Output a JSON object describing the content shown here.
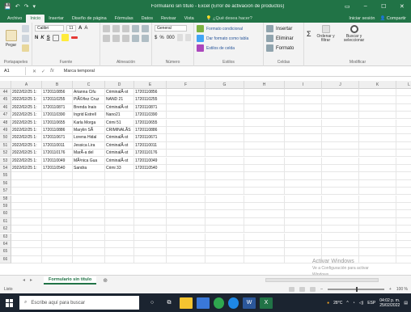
{
  "window": {
    "title": "Formulario sin título - Excel (Error de activación de productos)",
    "controls": {
      "ribbon_options": "▭",
      "minimize": "–",
      "maximize": "☐",
      "close": "✕"
    },
    "quick_access": [
      "💾",
      "↶",
      "↷",
      "▾"
    ]
  },
  "tabs": {
    "items": [
      "Archivo",
      "Inicio",
      "Insertar",
      "Diseño de página",
      "Fórmulas",
      "Datos",
      "Revisar",
      "Vista"
    ],
    "active_index": 1,
    "search": "¿Qué desea hacer?",
    "signin": "Iniciar sesión",
    "share": "Compartir"
  },
  "ribbon": {
    "clipboard": {
      "paste": "Pegar",
      "label": "Portapapeles"
    },
    "font": {
      "name": "Calibri",
      "size": "11",
      "label": "Fuente",
      "bold": "N",
      "italic": "K",
      "underline": "S",
      "grow": "A",
      "shrink": "A"
    },
    "alignment": {
      "label": "Alineación"
    },
    "number": {
      "format": "General",
      "label": "Número",
      "currency": "$",
      "percent": "%",
      "thousands": "000"
    },
    "styles": {
      "conditional": "Formato condicional",
      "as_table": "Dar formato como tabla",
      "cell_styles": "Estilos de celda",
      "label": "Estilos"
    },
    "cells": {
      "insert": "Insertar",
      "delete": "Eliminar",
      "format": "Formato",
      "label": "Celdas"
    },
    "editing": {
      "sort": "Ordenar y filtrar",
      "find": "Buscar y seleccionar",
      "label": "Modificar"
    }
  },
  "formula_bar": {
    "name_box": "A1",
    "fx": "fx",
    "cancel": "✕",
    "enter": "✓",
    "content": "Marca temporal"
  },
  "columns": [
    "A",
    "B",
    "C",
    "D",
    "E",
    "F",
    "G",
    "H",
    "I",
    "J",
    "K",
    "L"
  ],
  "rows": [
    {
      "n": "44",
      "a": "2022/02/25 1:",
      "b": "1720110856",
      "c": "Arianna Cifu",
      "d": "CriminalÃ-st",
      "e": "1720110856"
    },
    {
      "n": "45",
      "a": "2022/02/25 1:",
      "b": "1720110255",
      "c": "PiÃ©ñez Cruz",
      "d": "NAND 21",
      "e": "1720110255"
    },
    {
      "n": "46",
      "a": "2022/02/25 1:",
      "b": "1720110871",
      "c": "Brenda Inais",
      "d": "CriminalÃ-st",
      "e": "1720110871"
    },
    {
      "n": "47",
      "a": "2022/02/25 1:",
      "b": "1720110390",
      "c": "Ingrid Estrell",
      "d": "Nano21",
      "e": "1720110390"
    },
    {
      "n": "48",
      "a": "2022/02/25 1:",
      "b": "1720110655",
      "c": "Karla Morga",
      "d": "Crimi 51",
      "e": "1720110655"
    },
    {
      "n": "49",
      "a": "2022/02/25 1:",
      "b": "1720110886",
      "c": "Marylin SÃ",
      "d": "CRIMINALÃS",
      "e": "1720110886"
    },
    {
      "n": "50",
      "a": "2022/02/25 1:",
      "b": "1720110671",
      "c": "Lorena Hidal",
      "d": "CriminalÃ-st",
      "e": "1720110671"
    },
    {
      "n": "51",
      "a": "2022/02/25 1:",
      "b": "1720110011",
      "c": "Jessica Lira",
      "d": "CriminalÃ-st",
      "e": "1720110011"
    },
    {
      "n": "52",
      "a": "2022/02/25 1:",
      "b": "1720110176",
      "c": "MarÃ-a del",
      "d": "CriminalÃ-st",
      "e": "1720110176"
    },
    {
      "n": "53",
      "a": "2022/02/25 1:",
      "b": "1720110049",
      "c": "MÃ³nica Gua",
      "d": "CriminalÃ-st",
      "e": "1720110049"
    },
    {
      "n": "54",
      "a": "2022/02/25 1:",
      "b": "1720110540",
      "c": "Sandra",
      "d": "Crimi 33",
      "e": "1720110540"
    },
    {
      "n": "55"
    },
    {
      "n": "56"
    },
    {
      "n": "57"
    },
    {
      "n": "58"
    },
    {
      "n": "59"
    },
    {
      "n": "60"
    },
    {
      "n": "61"
    },
    {
      "n": "62"
    },
    {
      "n": "63"
    },
    {
      "n": "64"
    },
    {
      "n": "65"
    },
    {
      "n": "66"
    }
  ],
  "watermark": {
    "line1": "Activar Windows",
    "line2": "Ve a Configuración para activar",
    "line3": "Windows."
  },
  "sheet": {
    "tab": "Formulario sin título",
    "add": "⊕",
    "nav_prev": "◂",
    "nav_next": "▸"
  },
  "status": {
    "ready": "Listo",
    "zoom": "100 %"
  },
  "taskbar": {
    "search_placeholder": "Escribe aquí para buscar",
    "weather": "28°C",
    "language": "ESP",
    "time": "04:02 p. m.",
    "date": "25/02/2022"
  },
  "colors": {
    "excel_green": "#217346",
    "taskbar": "#1b2430"
  }
}
